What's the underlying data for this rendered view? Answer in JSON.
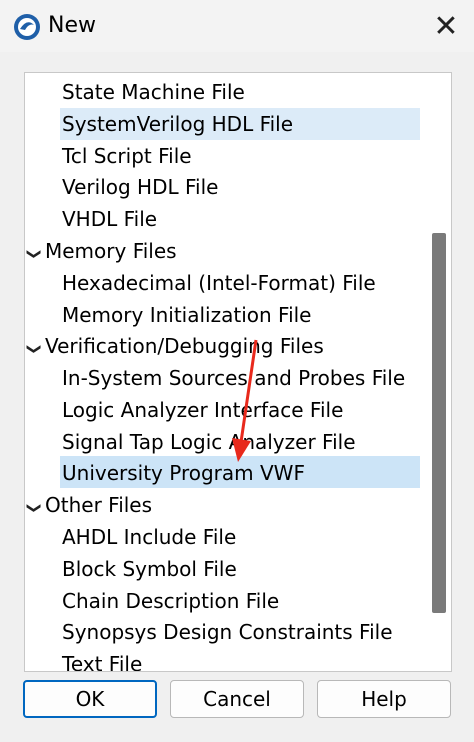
{
  "window": {
    "title": "New",
    "close_glyph": "✕",
    "icon": "quartus-app-icon"
  },
  "tree": {
    "rows": [
      {
        "label": "State Machine File",
        "kind": "child"
      },
      {
        "label": "SystemVerilog HDL File",
        "kind": "child",
        "highlighted": true
      },
      {
        "label": "Tcl Script File",
        "kind": "child"
      },
      {
        "label": "Verilog HDL File",
        "kind": "child"
      },
      {
        "label": "VHDL File",
        "kind": "child"
      },
      {
        "label": "Memory Files",
        "kind": "group",
        "expanded": true
      },
      {
        "label": "Hexadecimal (Intel-Format) File",
        "kind": "child"
      },
      {
        "label": "Memory Initialization File",
        "kind": "child"
      },
      {
        "label": "Verification/Debugging Files",
        "kind": "group",
        "expanded": true
      },
      {
        "label": "In-System Sources and Probes File",
        "kind": "child"
      },
      {
        "label": "Logic Analyzer Interface File",
        "kind": "child"
      },
      {
        "label": "Signal Tap Logic Analyzer File",
        "kind": "child"
      },
      {
        "label": "University Program VWF",
        "kind": "child",
        "selected": true
      },
      {
        "label": "Other Files",
        "kind": "group",
        "expanded": true
      },
      {
        "label": "AHDL Include File",
        "kind": "child"
      },
      {
        "label": "Block Symbol File",
        "kind": "child"
      },
      {
        "label": "Chain Description File",
        "kind": "child"
      },
      {
        "label": "Synopsys Design Constraints File",
        "kind": "child"
      },
      {
        "label": "Text File",
        "kind": "child"
      }
    ],
    "expand_glyph": "❯"
  },
  "scrollbar": {
    "position": 0.55
  },
  "buttons": {
    "ok": "OK",
    "cancel": "Cancel",
    "help": "Help"
  },
  "colors": {
    "selection": "#cce4f7",
    "hover": "#dcebf8",
    "accent": "#0067c0",
    "annotation_arrow": "#e8291c"
  }
}
